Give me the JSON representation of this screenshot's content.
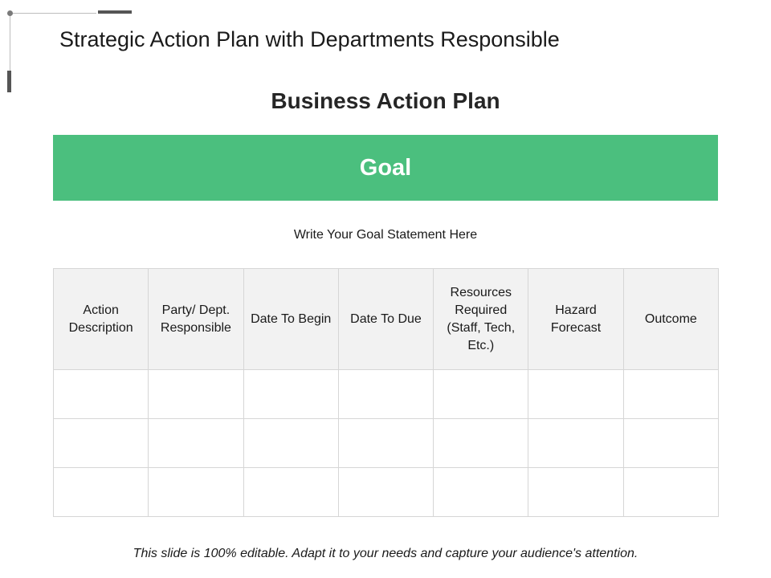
{
  "header": {
    "title": "Strategic Action Plan with Departments Responsible"
  },
  "plan": {
    "subtitle": "Business Action Plan",
    "goal_label": "Goal",
    "goal_statement": "Write Your Goal Statement Here",
    "accent_color": "#4bbf7e"
  },
  "table": {
    "columns": [
      "Action Description",
      "Party/ Dept. Responsible",
      "Date To Begin",
      "Date To Due",
      "Resources Required (Staff, Tech, Etc.)",
      "Hazard Forecast",
      "Outcome"
    ],
    "rows": [
      [
        "",
        "",
        "",
        "",
        "",
        "",
        ""
      ],
      [
        "",
        "",
        "",
        "",
        "",
        "",
        ""
      ],
      [
        "",
        "",
        "",
        "",
        "",
        "",
        ""
      ]
    ]
  },
  "footer": {
    "note": "This slide is 100% editable. Adapt it to your needs and capture your audience's attention."
  }
}
